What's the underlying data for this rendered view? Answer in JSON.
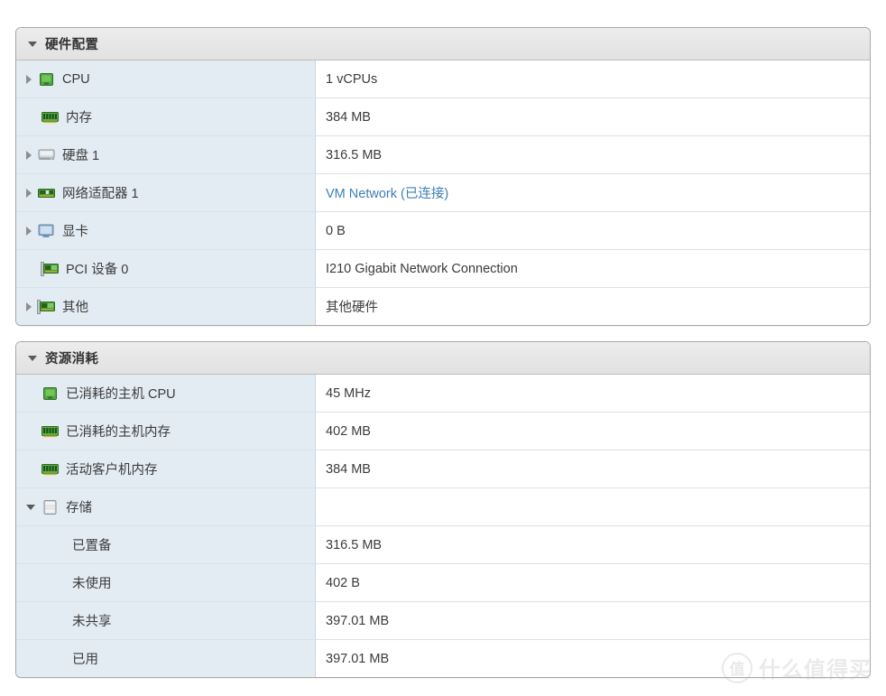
{
  "watermark": {
    "badge": "值",
    "text": "什么值得买"
  },
  "sections": [
    {
      "id": "hardware",
      "title": "硬件配置",
      "expanded": true,
      "twisty": "down",
      "rows": [
        {
          "twisty": "right",
          "icon": "cpu-icon",
          "label": "CPU",
          "value": "1 vCPUs",
          "link": false,
          "indent": 0
        },
        {
          "twisty": "none",
          "icon": "memory-icon",
          "label": "内存",
          "value": "384 MB",
          "link": false,
          "indent": 0
        },
        {
          "twisty": "right",
          "icon": "harddisk-icon",
          "label": "硬盘 1",
          "value": "316.5 MB",
          "link": false,
          "indent": 0
        },
        {
          "twisty": "right",
          "icon": "network-adapter-icon",
          "label": "网络适配器 1",
          "value": "VM Network (已连接)",
          "link": true,
          "indent": 0
        },
        {
          "twisty": "right",
          "icon": "monitor-icon",
          "label": "显卡",
          "value": "0 B",
          "link": false,
          "indent": 0
        },
        {
          "twisty": "none",
          "icon": "pci-device-icon",
          "label": "PCI 设备 0",
          "value": "I210 Gigabit Network Connection",
          "link": false,
          "indent": 0
        },
        {
          "twisty": "right",
          "icon": "pci-device-icon",
          "label": "其他",
          "value": "其他硬件",
          "link": false,
          "indent": 0
        }
      ]
    },
    {
      "id": "resource-consumption",
      "title": "资源消耗",
      "expanded": true,
      "twisty": "down",
      "rows": [
        {
          "twisty": "none",
          "icon": "cpu-icon",
          "label": "已消耗的主机 CPU",
          "value": "45 MHz",
          "link": false,
          "indent": 0
        },
        {
          "twisty": "none",
          "icon": "memory-icon",
          "label": "已消耗的主机内存",
          "value": "402 MB",
          "link": false,
          "indent": 0
        },
        {
          "twisty": "none",
          "icon": "memory-icon",
          "label": "活动客户机内存",
          "value": "384 MB",
          "link": false,
          "indent": 0
        },
        {
          "twisty": "down",
          "icon": "storage-icon",
          "label": "存储",
          "value": "",
          "link": false,
          "indent": 0
        },
        {
          "twisty": "none",
          "icon": "none",
          "label": "已置备",
          "value": "316.5 MB",
          "link": false,
          "indent": 1
        },
        {
          "twisty": "none",
          "icon": "none",
          "label": "未使用",
          "value": "402 B",
          "link": false,
          "indent": 1
        },
        {
          "twisty": "none",
          "icon": "none",
          "label": "未共享",
          "value": "397.01 MB",
          "link": false,
          "indent": 1
        },
        {
          "twisty": "none",
          "icon": "none",
          "label": "已用",
          "value": "397.01 MB",
          "link": false,
          "indent": 1
        }
      ]
    }
  ]
}
